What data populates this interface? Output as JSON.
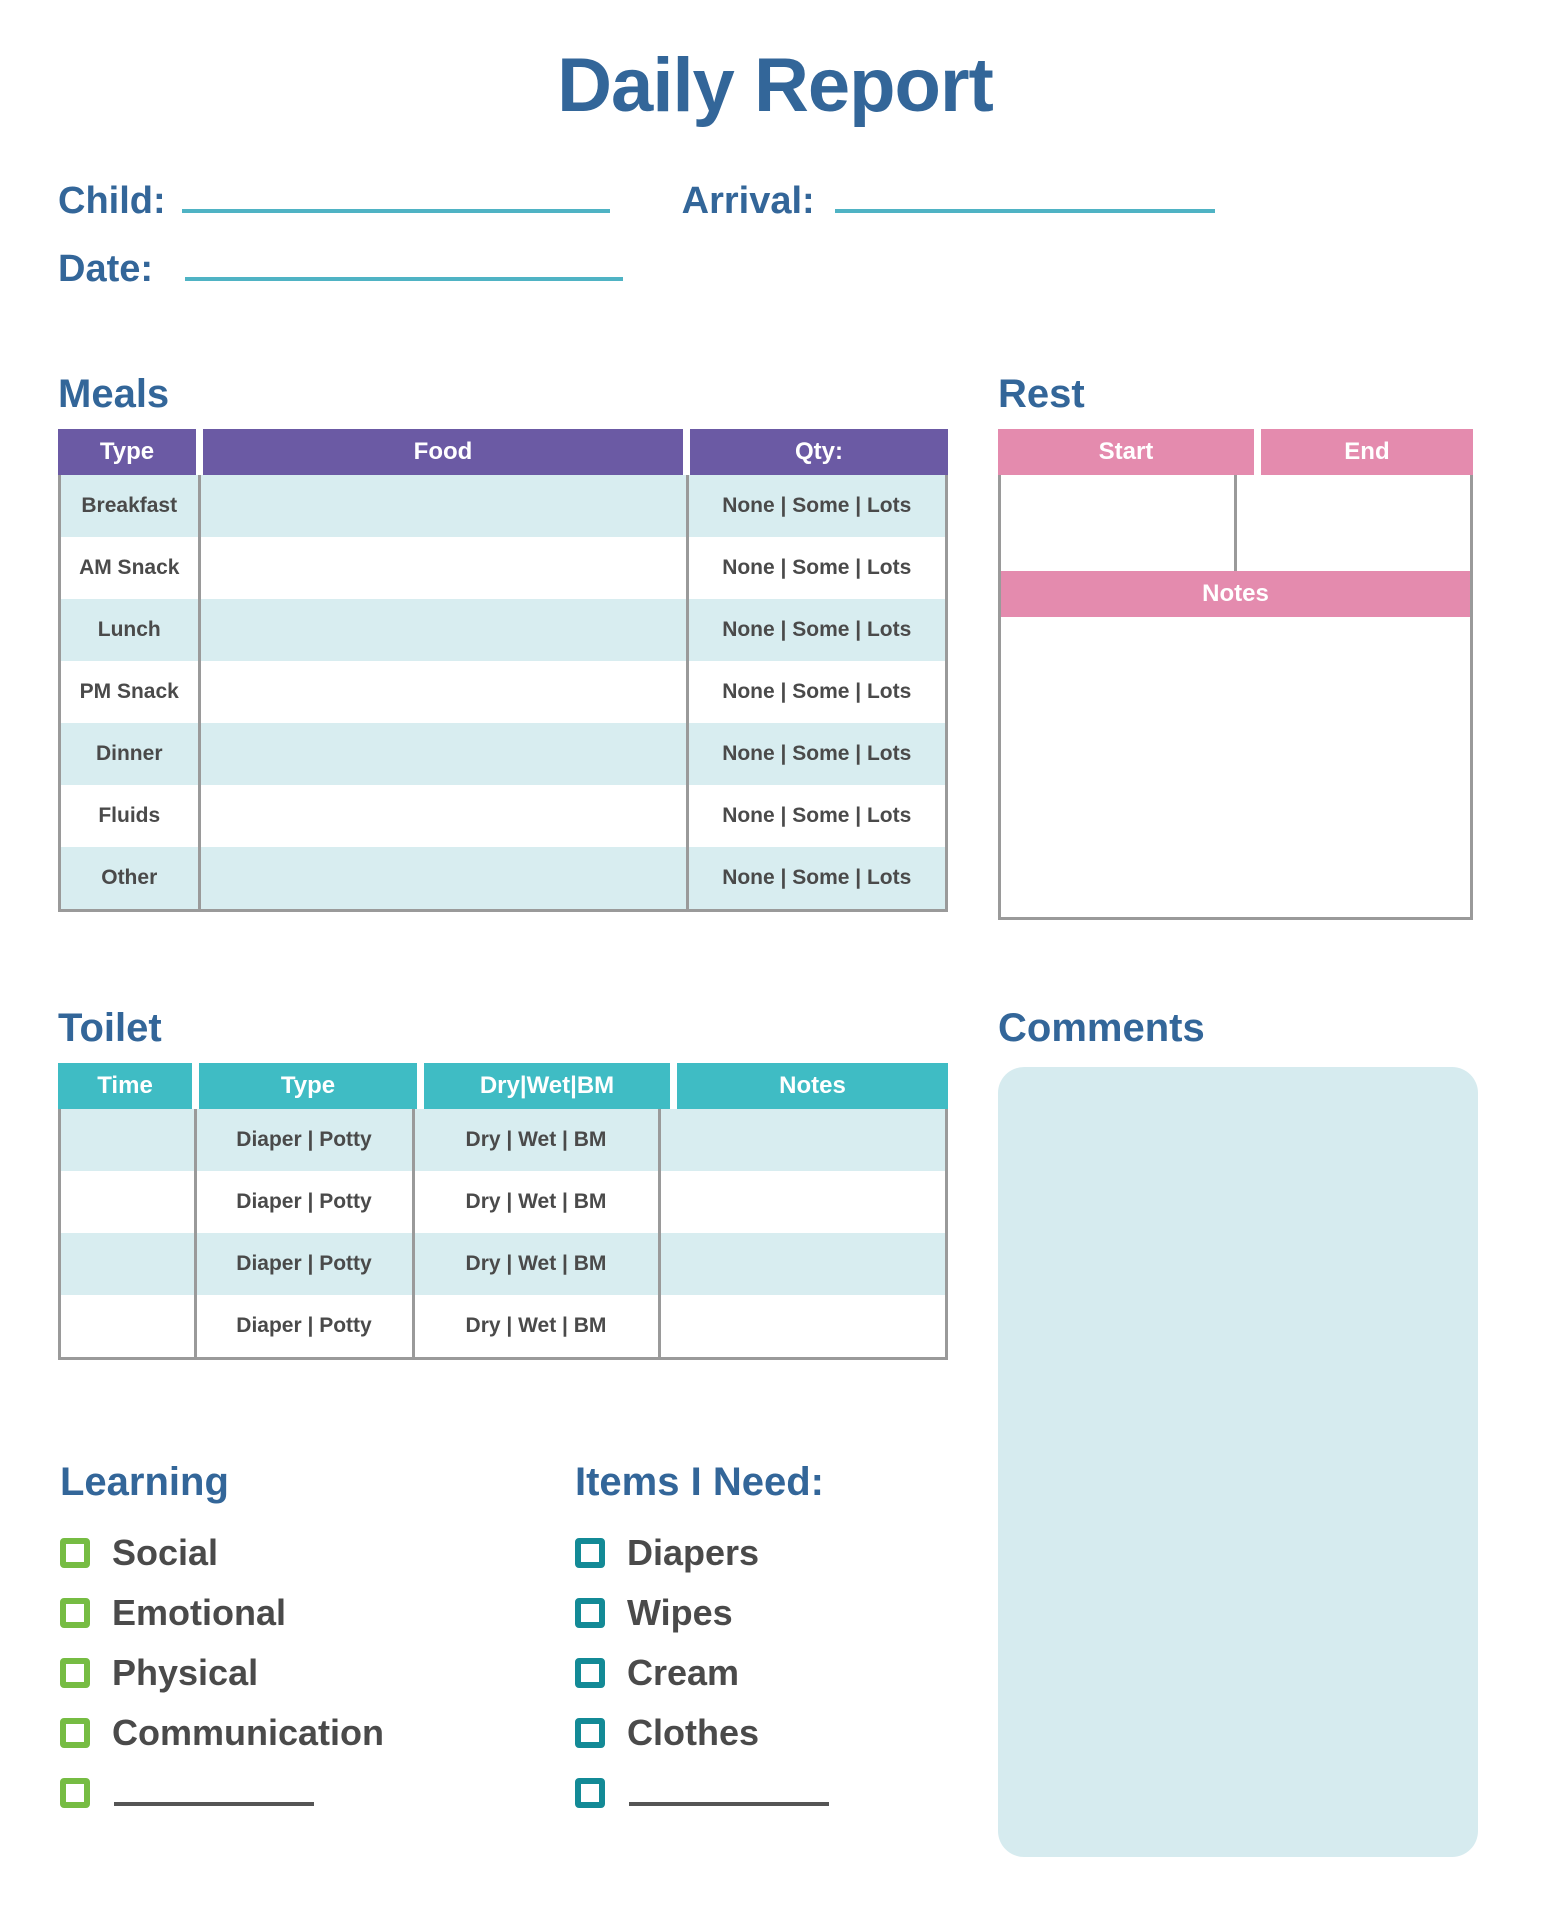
{
  "title": "Daily Report",
  "identity": {
    "child_label": "Child:",
    "date_label": "Date:",
    "arrival_label": "Arrival:",
    "child_value": "",
    "date_value": "",
    "arrival_value": ""
  },
  "meals": {
    "heading": "Meals",
    "columns": [
      "Type",
      "Food",
      "Qty:"
    ],
    "qty_options": "None  |  Some  |  Lots",
    "rows": [
      {
        "type": "Breakfast",
        "food": "",
        "qty": "None  |  Some  |  Lots"
      },
      {
        "type": "AM Snack",
        "food": "",
        "qty": "None  |  Some  |  Lots"
      },
      {
        "type": "Lunch",
        "food": "",
        "qty": "None  |  Some  |  Lots"
      },
      {
        "type": "PM Snack",
        "food": "",
        "qty": "None  |  Some  |  Lots"
      },
      {
        "type": "Dinner",
        "food": "",
        "qty": "None  |  Some  |  Lots"
      },
      {
        "type": "Fluids",
        "food": "",
        "qty": "None  |  Some  |  Lots"
      },
      {
        "type": "Other",
        "food": "",
        "qty": "None  |  Some  |  Lots"
      }
    ]
  },
  "rest": {
    "heading": "Rest",
    "start_label": "Start",
    "end_label": "End",
    "notes_label": "Notes",
    "start_value": "",
    "end_value": "",
    "notes_value": ""
  },
  "toilet": {
    "heading": "Toilet",
    "columns": [
      "Time",
      "Type",
      "Dry|Wet|BM",
      "Notes"
    ],
    "rows": [
      {
        "time": "",
        "type": "Diaper  |  Potty",
        "dwb": "Dry  |  Wet  |  BM",
        "notes": ""
      },
      {
        "time": "",
        "type": "Diaper  |  Potty",
        "dwb": "Dry  |  Wet  |  BM",
        "notes": ""
      },
      {
        "time": "",
        "type": "Diaper  |  Potty",
        "dwb": "Dry  |  Wet  |  BM",
        "notes": ""
      },
      {
        "time": "",
        "type": "Diaper  |  Potty",
        "dwb": "Dry  |  Wet  |  BM",
        "notes": ""
      }
    ]
  },
  "comments": {
    "heading": "Comments",
    "value": ""
  },
  "learning": {
    "heading": "Learning",
    "items": [
      "Social",
      "Emotional",
      "Physical",
      "Communication"
    ],
    "blank_item": ""
  },
  "items_needed": {
    "heading": "Items I Need:",
    "items": [
      "Diapers",
      "Wipes",
      "Cream",
      "Clothes"
    ],
    "blank_item": ""
  },
  "colors": {
    "heading_blue": "#336699",
    "meals_purple": "#6B5AA4",
    "rest_pink": "#E48BAE",
    "toilet_teal": "#3FBCC4",
    "row_tint": "#D8EDF0",
    "comments_bg": "#D6EBEF",
    "learning_green": "#76BC43",
    "items_teal": "#138A96",
    "rule_teal": "#4FB3C4",
    "border_gray": "#9A9A9A"
  }
}
